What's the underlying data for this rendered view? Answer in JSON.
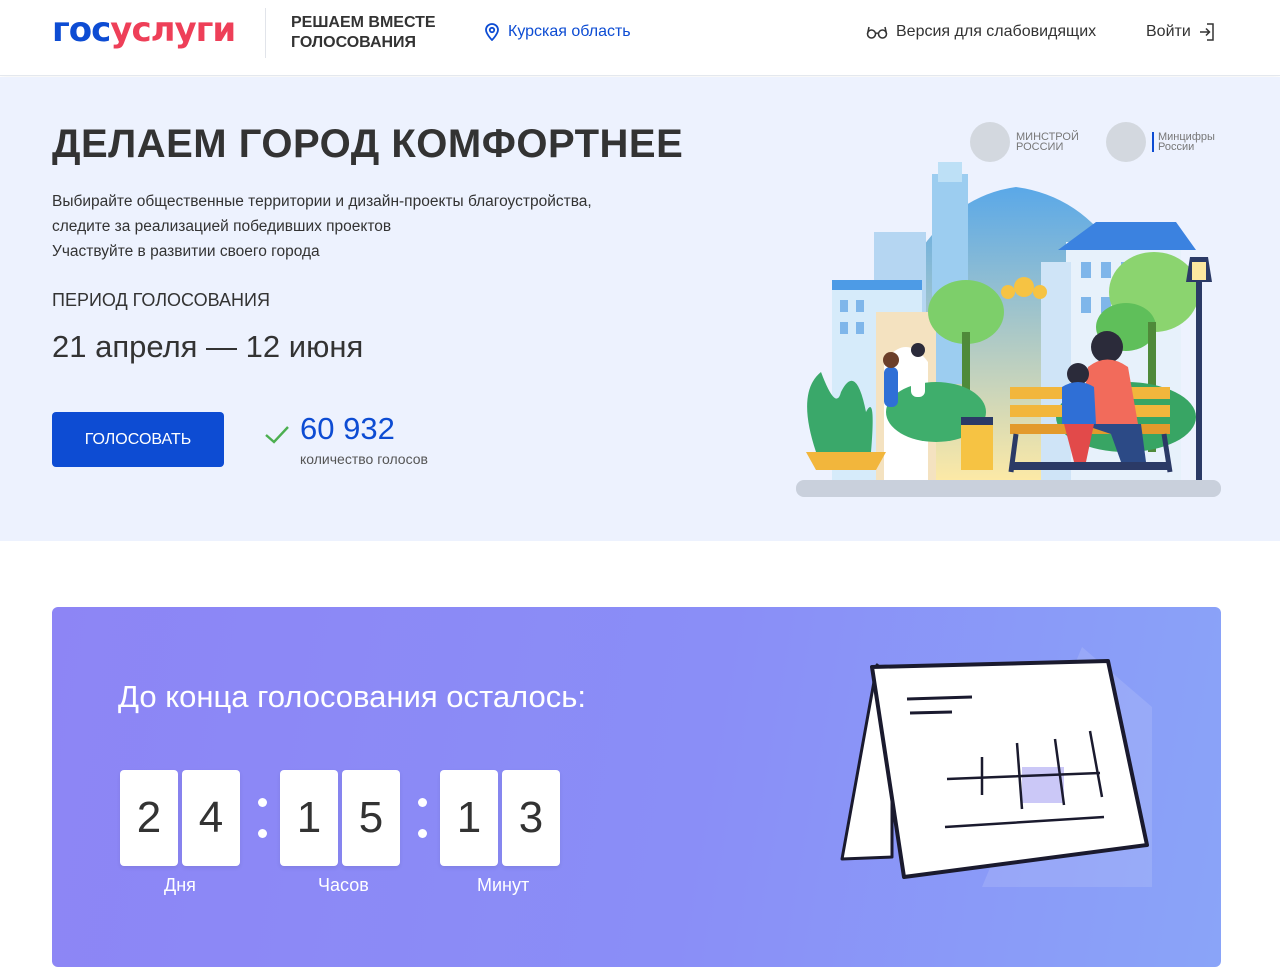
{
  "header": {
    "logo_part1": "гос",
    "logo_part2": "услуги",
    "project_title": "Решаем вместе голосования",
    "region": "Курская область",
    "accessibility": "Версия для слабовидящих",
    "login": "Войти"
  },
  "hero": {
    "title": "ДЕЛАЕМ ГОРОД КОМФОРТНЕЕ",
    "description_line1": "Выбирайте общественные территории и дизайн-проекты благоустройства,",
    "description_line2": "следите за реализацией победивших проектов",
    "description_line3": "Участвуйте в развитии своего города",
    "period_label": "ПЕРИОД ГОЛОСОВАНИЯ",
    "period_dates": "21 апреля — 12 июня",
    "vote_button": "Голосовать",
    "votes_count": "60 932",
    "votes_label": "количество голосов",
    "partner1_line1": "МИНСТРОЙ",
    "partner1_line2": "РОССИИ",
    "partner2_line1": "Минцифры",
    "partner2_line2": "России"
  },
  "countdown": {
    "title": "До конца голосования осталось:",
    "days": [
      "2",
      "4"
    ],
    "hours": [
      "1",
      "5"
    ],
    "minutes": [
      "1",
      "3"
    ],
    "days_label": "Дня",
    "hours_label": "Часов",
    "minutes_label": "Минут"
  },
  "colors": {
    "brand_blue": "#0d4cd3",
    "brand_red": "#ee3f58",
    "hero_bg": "#edf2fe",
    "countdown_bg": "#8a8ef7"
  },
  "icons": [
    "location-pin-icon",
    "glasses-icon",
    "login-arrow-icon",
    "check-icon"
  ]
}
